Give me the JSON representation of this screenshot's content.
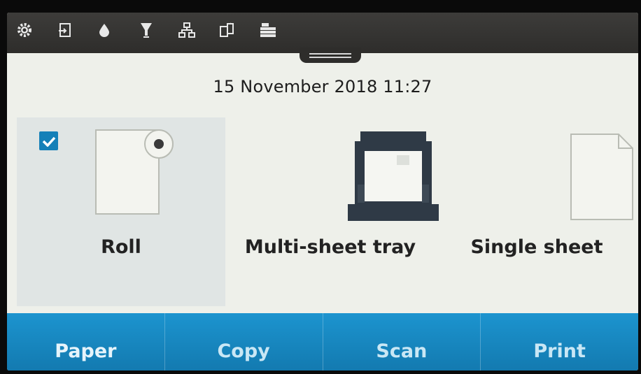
{
  "status_bar": {
    "icons": [
      "settings-icon",
      "paper-load-icon",
      "ink-drop-icon",
      "cleaning-icon",
      "network-icon",
      "mobile-print-icon",
      "paper-stack-icon"
    ]
  },
  "datetime": "15 November 2018 11:27",
  "sources": [
    {
      "label": "Roll",
      "icon": "roll-icon",
      "selected": true
    },
    {
      "label": "Multi-sheet tray",
      "icon": "tray-icon",
      "selected": false
    },
    {
      "label": "Single sheet",
      "icon": "sheet-icon",
      "selected": false
    }
  ],
  "tabs": [
    {
      "label": "Paper",
      "active": true
    },
    {
      "label": "Copy",
      "active": false
    },
    {
      "label": "Scan",
      "active": false
    },
    {
      "label": "Print",
      "active": false
    }
  ],
  "colors": {
    "status_bar": "#2e2d2b",
    "tab_bar": "#1c94cf",
    "checkbox": "#1580b8",
    "screen_bg": "#eef0ea"
  }
}
